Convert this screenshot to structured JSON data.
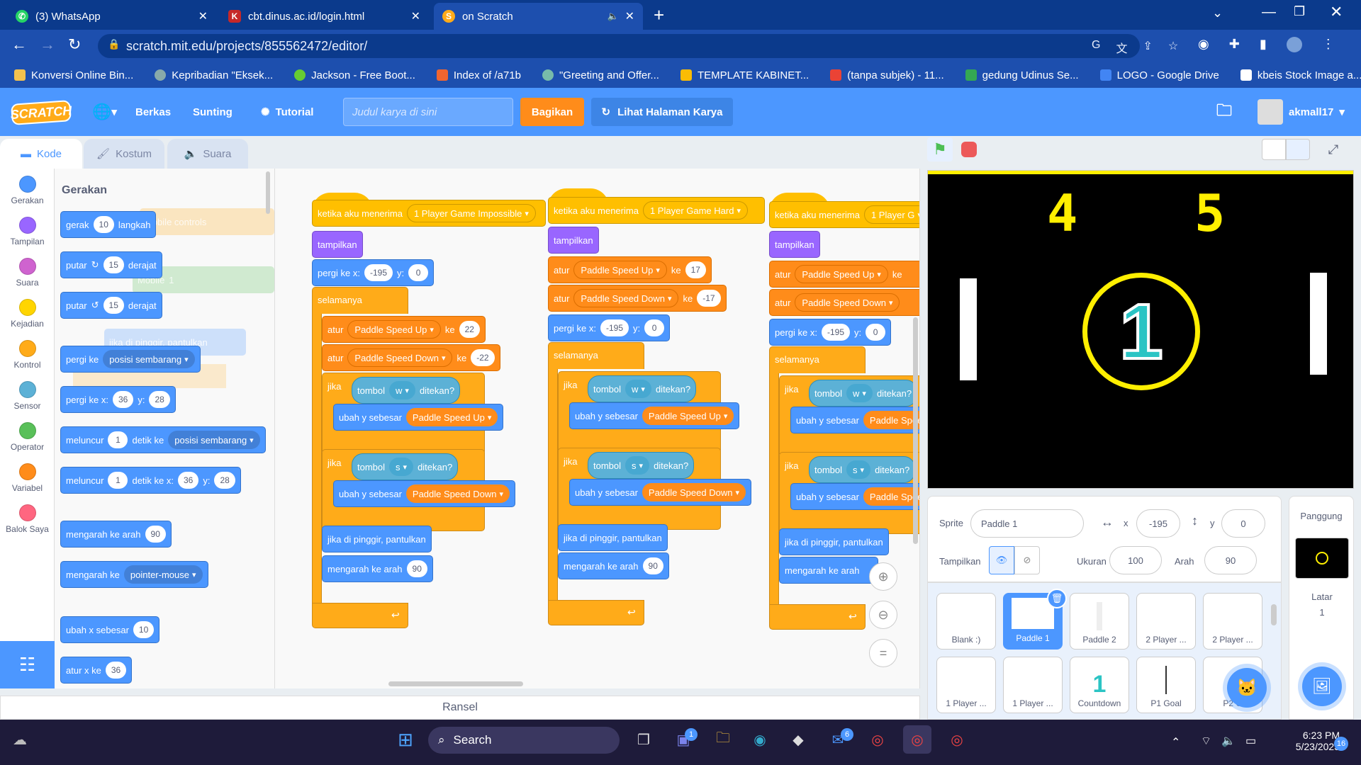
{
  "browser": {
    "tabs": [
      {
        "title": "(3) WhatsApp"
      },
      {
        "title": "cbt.dinus.ac.id/login.html"
      },
      {
        "title": "on Scratch"
      }
    ],
    "new_tab": "+",
    "url": "scratch.mit.edu/projects/855562472/editor/",
    "bookmarks": [
      "Konversi Online Bin...",
      "Kepribadian \"Eksek...",
      "Jackson - Free Boot...",
      "Index of /a71b",
      "\"Greeting and Offer...",
      "TEMPLATE KABINET...",
      "(tanpa subjek) - 11...",
      "gedung Udinus Se...",
      "LOGO - Google Drive",
      "kbeis Stock Image a..."
    ],
    "more": "»"
  },
  "menu": {
    "logo": "SCRATCH",
    "file": "Berkas",
    "edit": "Sunting",
    "tutorial": "Tutorial",
    "title_placeholder": "Judul karya di sini",
    "share": "Bagikan",
    "project_page": "Lihat Halaman Karya",
    "user": "akmall17"
  },
  "editor_tabs": {
    "code": "Kode",
    "costumes": "Kostum",
    "sounds": "Suara"
  },
  "categories": [
    {
      "label": "Gerakan",
      "color": "#4c97ff"
    },
    {
      "label": "Tampilan",
      "color": "#9966ff"
    },
    {
      "label": "Suara",
      "color": "#cf63cf"
    },
    {
      "label": "Kejadian",
      "color": "#ffd500"
    },
    {
      "label": "Kontrol",
      "color": "#ffab19"
    },
    {
      "label": "Sensor",
      "color": "#5cb1d6"
    },
    {
      "label": "Operator",
      "color": "#59c059"
    },
    {
      "label": "Variabel",
      "color": "#ff8c1a"
    },
    {
      "label": "Balok Saya",
      "color": "#ff6680"
    }
  ],
  "palette": {
    "heading": "Gerakan",
    "move": {
      "pre": "gerak",
      "val": "10",
      "post": "langkah"
    },
    "turn_right": {
      "pre": "putar",
      "val": "15",
      "post": "derajat"
    },
    "turn_left": {
      "pre": "putar",
      "val": "15",
      "post": "derajat"
    },
    "goto": {
      "pre": "pergi ke",
      "dd": "posisi sembarang"
    },
    "goto_xy": {
      "pre": "pergi ke x:",
      "x": "36",
      "ylab": "y:",
      "y": "28"
    },
    "glide": {
      "pre": "meluncur",
      "val": "1",
      "mid": "detik ke",
      "dd": "posisi sembarang"
    },
    "glide_xy": {
      "pre": "meluncur",
      "val": "1",
      "mid": "detik ke x:",
      "x": "36",
      "ylab": "y:",
      "y": "28"
    },
    "point_dir": {
      "pre": "mengarah ke arah",
      "val": "90"
    },
    "point_towards": {
      "pre": "mengarah ke",
      "dd": "pointer-mouse"
    },
    "change_x": {
      "pre": "ubah x sebesar",
      "val": "10"
    },
    "set_x": {
      "pre": "atur x ke",
      "val": "36"
    }
  },
  "scripts": {
    "common": {
      "show": "tampilkan",
      "goto": "pergi ke x:",
      "ylab": "y:",
      "forever": "selamanya",
      "set": "atur",
      "to": "ke",
      "if": "jika",
      "key": "tombol",
      "pressed": "ditekan?",
      "change_y": "ubah y sebesar",
      "bounce": "jika di pinggir, pantulkan",
      "point": "mengarah ke arah",
      "recv": "ketika aku menerima",
      "up": "Paddle Speed Up",
      "down": "Paddle Speed Down",
      "w": "w",
      "s": "s"
    },
    "s1": {
      "msg": "1 Player Game Impossible",
      "x": "-195",
      "y": "0",
      "up_val": "22",
      "down_val": "-22",
      "dir": "90"
    },
    "s2": {
      "msg": "1 Player Game Hard",
      "x": "-195",
      "y": "0",
      "up_val": "17",
      "down_val": "-17",
      "dir": "90"
    },
    "s3": {
      "msg": "1 Player G",
      "x": "-195",
      "y": "0",
      "up_val": "",
      "dir": ""
    }
  },
  "ghost": {
    "a": "Mobile controls",
    "b": "Mobile",
    "c": "1",
    "d": "jika di pinggir, pantulkan"
  },
  "backpack": "Ransel",
  "stage": {
    "score_left": "4",
    "score_right": "5",
    "countdown": "1"
  },
  "sprite_info": {
    "sprite_label": "Sprite",
    "name": "Paddle 1",
    "x_label": "x",
    "x": "-195",
    "y_label": "y",
    "y": "0",
    "show_label": "Tampilkan",
    "size_label": "Ukuran",
    "size": "100",
    "dir_label": "Arah",
    "dir": "90"
  },
  "sprites": [
    "Blank :)",
    "Paddle 1",
    "Paddle 2",
    "2 Player ...",
    "2 Player ...",
    "1 Player ...",
    "1 Player ...",
    "Countdown",
    "P1 Goal",
    "P2 G"
  ],
  "stage_panel": {
    "title": "Panggung",
    "backdrops_label": "Latar",
    "backdrops": "1"
  },
  "taskbar": {
    "search": "Search",
    "time": "6:23 PM",
    "date": "5/23/2023",
    "notif": "16",
    "badge1": "1",
    "badge2": "6"
  }
}
